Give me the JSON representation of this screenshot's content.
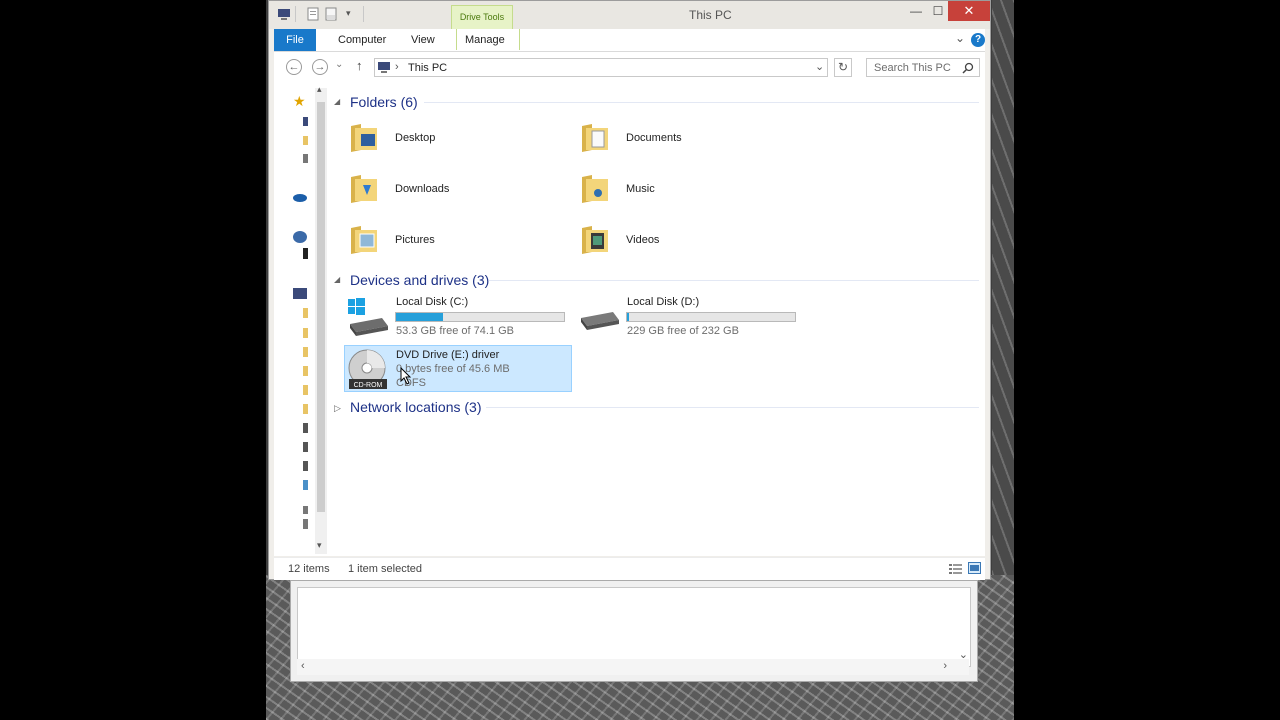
{
  "window": {
    "title": "This PC",
    "minimize": "—",
    "maximize": "☐",
    "close": "✕"
  },
  "ribbon": {
    "contextual_group": "Drive Tools",
    "tabs": [
      "File",
      "Computer",
      "View",
      "Manage"
    ],
    "expand": "⌄",
    "help": "?"
  },
  "navigation": {
    "back": "←",
    "forward": "→",
    "recent": "⌄",
    "up": "↑",
    "address_separator": "›",
    "address_path": "This PC",
    "address_dropdown": "⌄",
    "refresh": "↻",
    "search_placeholder": "Search This PC",
    "search_icon": "search-icon"
  },
  "sections": {
    "folders": "Folders (6)",
    "devices": "Devices and drives (3)",
    "network": "Network locations (3)"
  },
  "folders": [
    {
      "name": "Desktop",
      "icon": "desktop-folder-icon"
    },
    {
      "name": "Documents",
      "icon": "documents-folder-icon"
    },
    {
      "name": "Downloads",
      "icon": "downloads-folder-icon"
    },
    {
      "name": "Music",
      "icon": "music-folder-icon"
    },
    {
      "name": "Pictures",
      "icon": "pictures-folder-icon"
    },
    {
      "name": "Videos",
      "icon": "videos-folder-icon"
    }
  ],
  "drives": [
    {
      "name": "Local Disk (C:)",
      "free": "53.3 GB free of 74.1 GB",
      "used_fraction": 0.28,
      "icon": "windows-drive-icon"
    },
    {
      "name": "Local Disk (D:)",
      "free": "229 GB free of 232 GB",
      "used_fraction": 0.013,
      "icon": "hard-drive-icon"
    },
    {
      "name": "DVD Drive (E:) driver",
      "free": "0 bytes free of 45.6 MB",
      "fs": "CDFS",
      "icon": "dvd-drive-icon",
      "icon_label": "CD-ROM"
    }
  ],
  "status": {
    "item_count": "12 items",
    "selected": "1 item selected"
  },
  "back_window": {
    "scroll_left": "‹",
    "scroll_right": "›",
    "scroll_down": "⌄"
  },
  "colors": {
    "file_tab": "#1979ca",
    "close_button": "#c7413a",
    "selection": "#cce8ff",
    "section_heading": "#1e3287",
    "drive_fill": "#26a0da"
  }
}
